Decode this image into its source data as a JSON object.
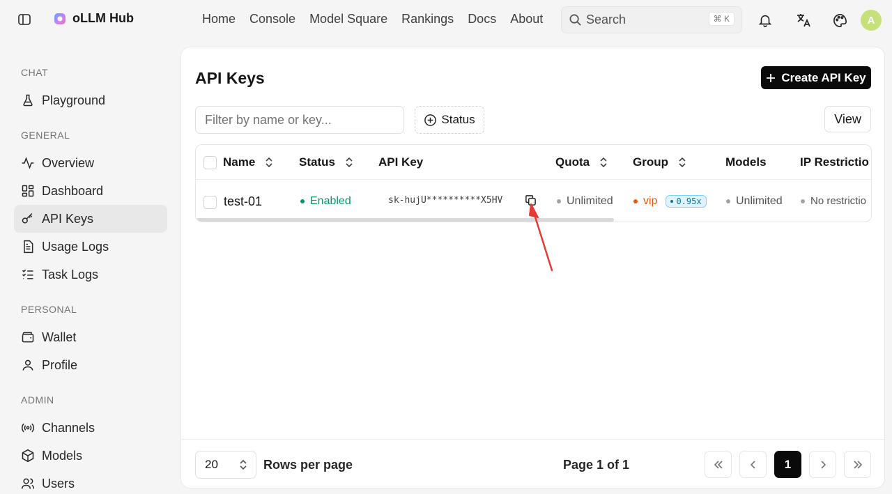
{
  "app": {
    "name": "oLLM Hub",
    "avatar_initial": "A"
  },
  "nav": [
    "Home",
    "Console",
    "Model Square",
    "Rankings",
    "Docs",
    "About"
  ],
  "search": {
    "label": "Search",
    "shortcut": "⌘ K"
  },
  "sidebar": {
    "groups": {
      "chat": "CHAT",
      "general": "GENERAL",
      "personal": "PERSONAL",
      "admin": "ADMIN"
    },
    "items": {
      "playground": "Playground",
      "overview": "Overview",
      "dashboard": "Dashboard",
      "api_keys": "API Keys",
      "usage_logs": "Usage Logs",
      "task_logs": "Task Logs",
      "wallet": "Wallet",
      "profile": "Profile",
      "channels": "Channels",
      "models": "Models",
      "users": "Users"
    }
  },
  "page": {
    "title": "API Keys",
    "create_button": "Create API Key",
    "filter_placeholder": "Filter by name or key...",
    "status_filter": "Status",
    "view_button": "View"
  },
  "table": {
    "headers": {
      "name": "Name",
      "status": "Status",
      "api_key": "API Key",
      "quota": "Quota",
      "group": "Group",
      "models": "Models",
      "ip": "IP Restrictio"
    },
    "rows": [
      {
        "name": "test-01",
        "status": "Enabled",
        "api_key": "sk-hujU**********X5HV",
        "quota": "Unlimited",
        "group": "vip",
        "ratio": "0.95x",
        "models": "Unlimited",
        "ip": "No restrictio"
      }
    ]
  },
  "pagination": {
    "rows_per_page": "20",
    "rows_label": "Rows per page",
    "page_info": "Page 1 of 1",
    "current_page": "1"
  },
  "colors": {
    "accent": "#0a0a0a",
    "enabled": "#059669",
    "vip": "#ea580c",
    "annotation_arrow": "#e53935"
  }
}
